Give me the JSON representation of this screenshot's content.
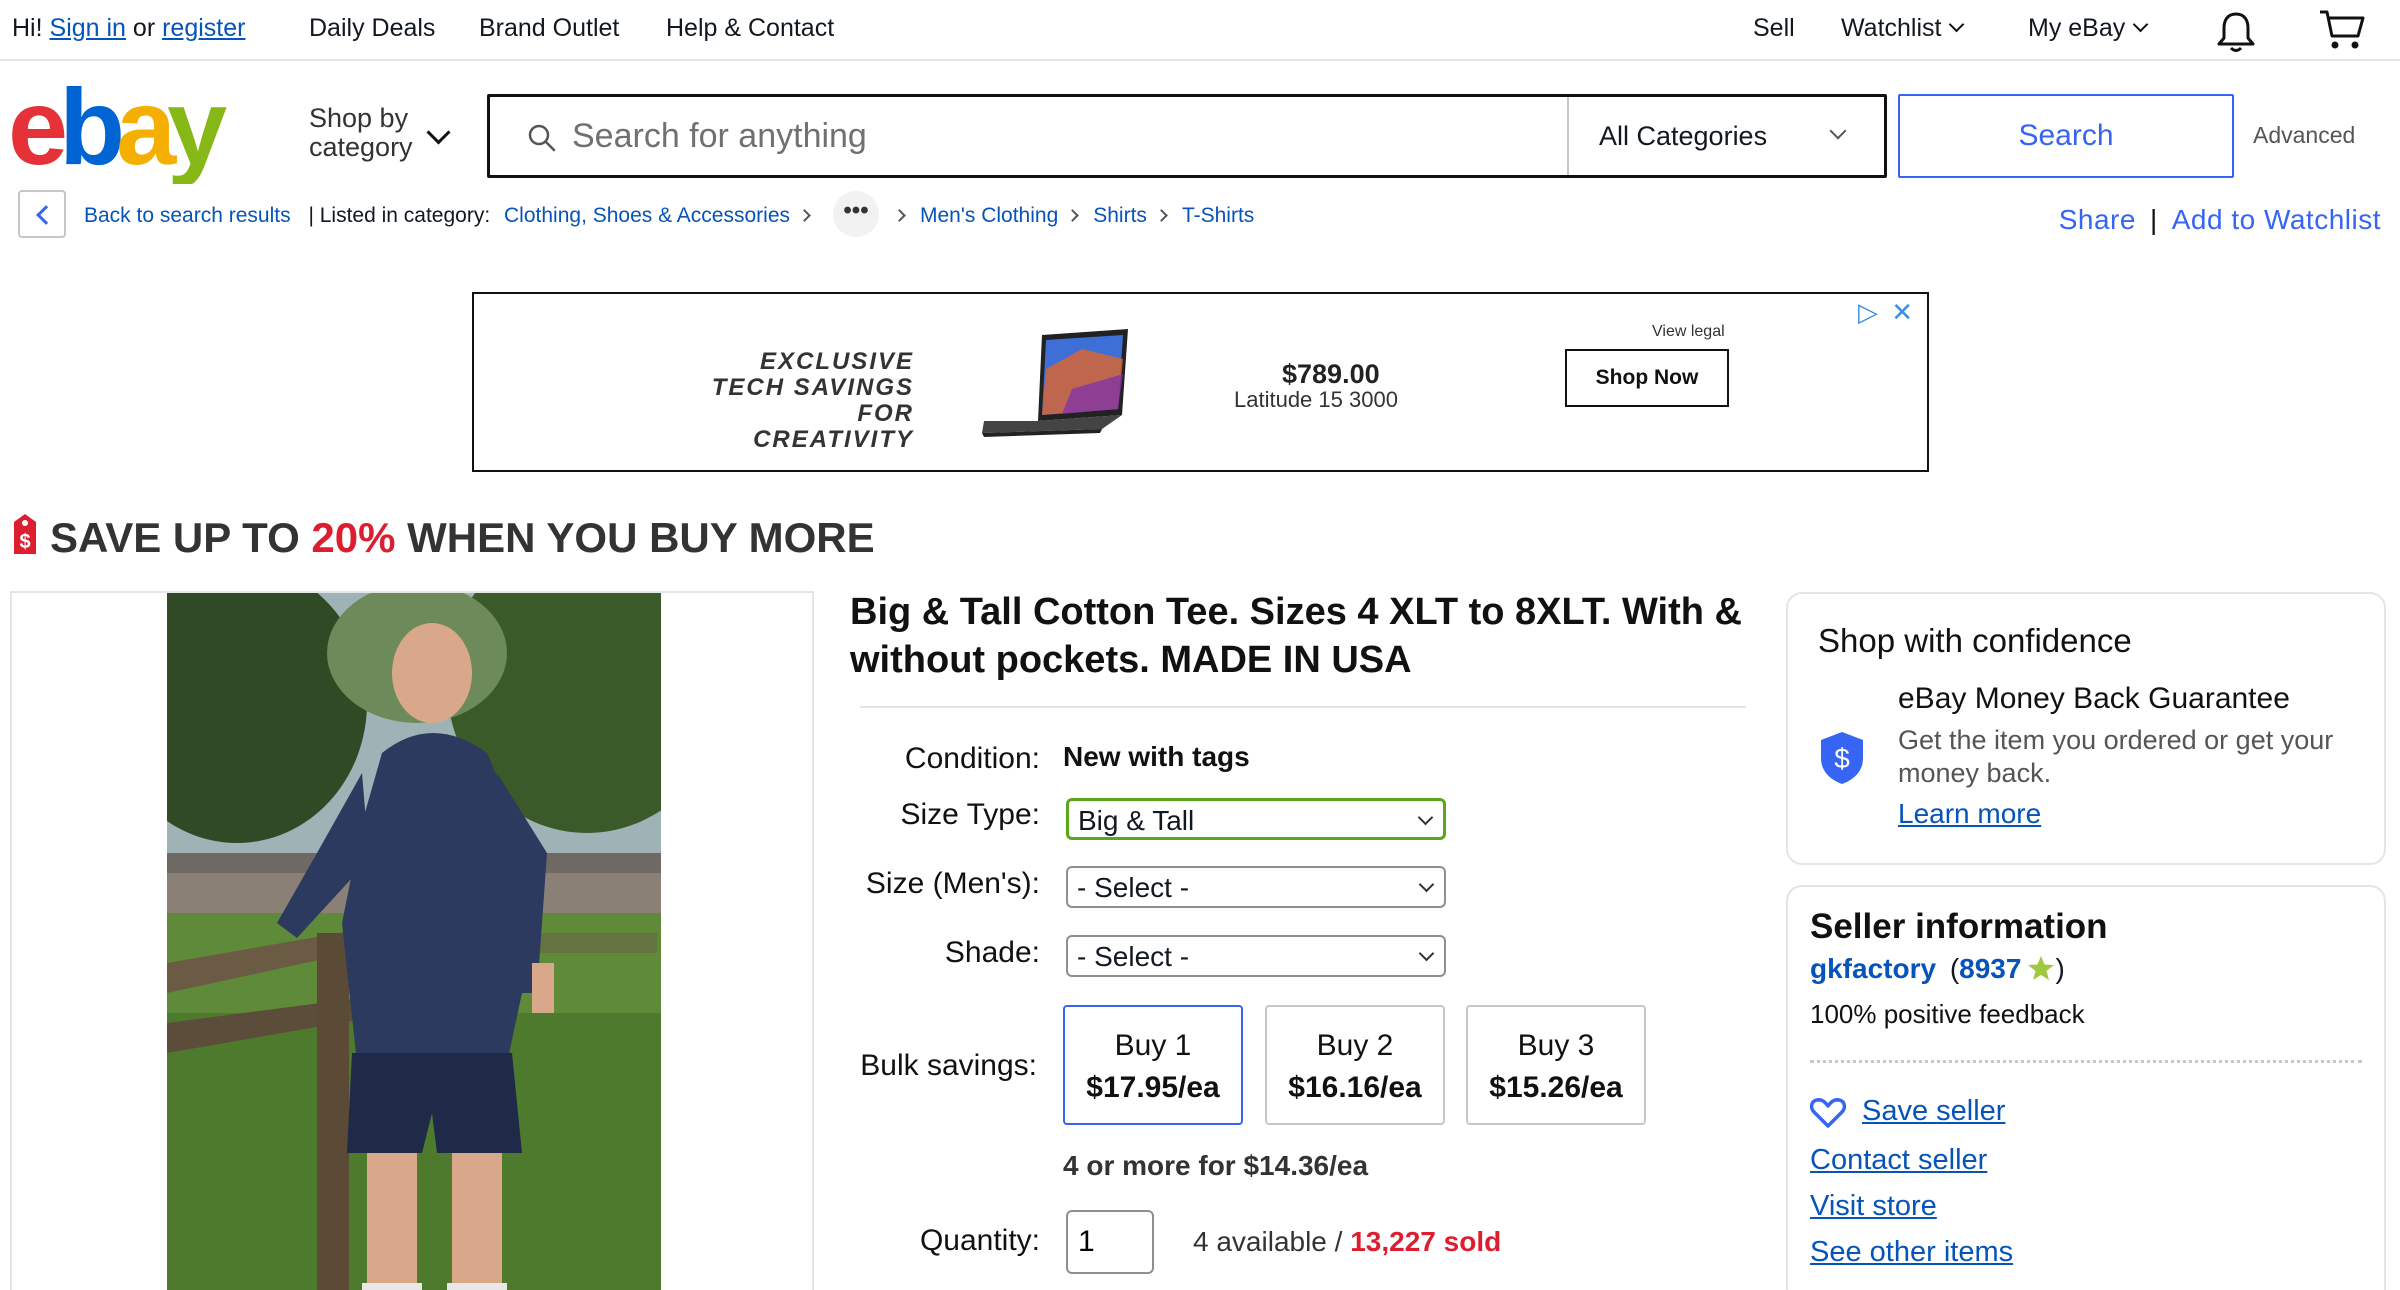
{
  "topnav": {
    "greeting": "Hi!",
    "sign_in": "Sign in",
    "or": "or",
    "register": "register",
    "daily_deals": "Daily Deals",
    "brand_outlet": "Brand Outlet",
    "help_contact": "Help & Contact",
    "sell": "Sell",
    "watchlist": "Watchlist",
    "my_ebay": "My eBay"
  },
  "header": {
    "shop_by_line1": "Shop by",
    "shop_by_line2": "category",
    "search_placeholder": "Search for anything",
    "category": "All Categories",
    "search_button": "Search",
    "advanced": "Advanced"
  },
  "breadcrumb": {
    "back": "Back to search results",
    "listed_in": "| Listed in category:",
    "items": [
      "Clothing, Shoes & Accessories",
      "Men's Clothing",
      "Shirts",
      "T-Shirts"
    ],
    "share": "Share",
    "add_watchlist": "Add to Watchlist"
  },
  "ad": {
    "tagline": "EXCLUSIVE TECH SAVINGS FOR CREATIVITY",
    "price": "$789.00",
    "model": "Latitude 15 3000",
    "legal": "View legal",
    "button": "Shop Now"
  },
  "promo": {
    "prefix": "SAVE UP TO",
    "percent": "20%",
    "suffix": "WHEN YOU BUY MORE"
  },
  "listing": {
    "title": "Big & Tall Cotton Tee. Sizes 4 XLT to 8XLT. With & without pockets. MADE IN USA",
    "condition_label": "Condition:",
    "condition_value": "New with tags",
    "size_type_label": "Size Type:",
    "size_type_value": "Big & Tall",
    "size_label": "Size (Men's):",
    "size_value": "- Select -",
    "shade_label": "Shade:",
    "shade_value": "- Select -",
    "bulk_label": "Bulk savings:",
    "bulk": [
      {
        "qty": "Buy 1",
        "price": "$17.95/ea"
      },
      {
        "qty": "Buy 2",
        "price": "$16.16/ea"
      },
      {
        "qty": "Buy 3",
        "price": "$15.26/ea"
      }
    ],
    "four_more": "4 or more for $14.36/ea",
    "quantity_label": "Quantity:",
    "quantity_value": "1",
    "available": "4 available /",
    "sold": "13,227 sold"
  },
  "confidence": {
    "title": "Shop with confidence",
    "guarantee": "eBay Money Back Guarantee",
    "desc": "Get the item you ordered or get your money back.",
    "learn_more": "Learn more"
  },
  "seller": {
    "title": "Seller information",
    "name": "gkfactory",
    "feedback_open": "(",
    "feedback_count": "8937",
    "feedback_close": ")",
    "positive": "100% positive feedback",
    "save": "Save seller",
    "contact": "Contact seller",
    "visit": "Visit store",
    "other": "See other items"
  }
}
